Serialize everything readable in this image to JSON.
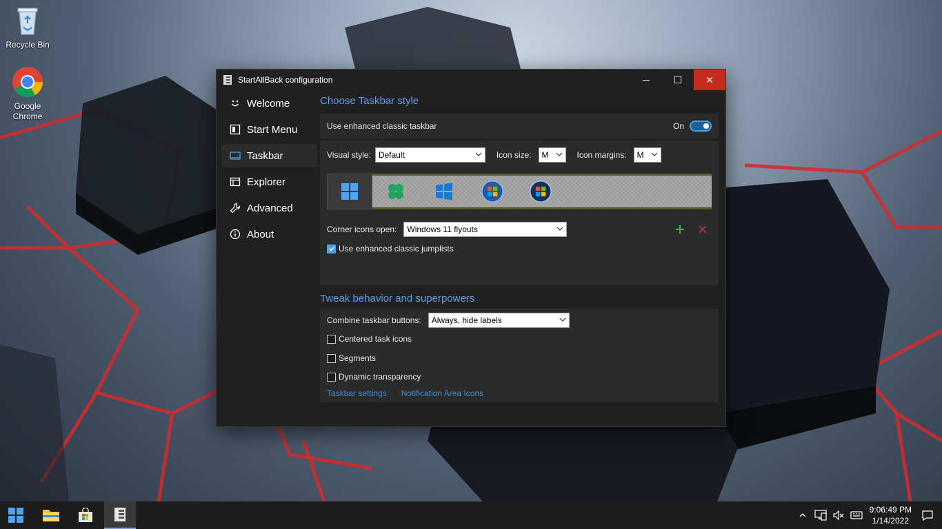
{
  "desktop": {
    "icons": [
      {
        "label": "Recycle Bin"
      },
      {
        "label": "Google Chrome"
      }
    ]
  },
  "window": {
    "title": "StartAllBack configuration",
    "controls": {
      "minimize": "─",
      "maximize": "☐",
      "close": "✕"
    }
  },
  "nav": {
    "items": [
      {
        "label": "Welcome",
        "icon": "smile-icon"
      },
      {
        "label": "Start Menu",
        "icon": "start-menu-icon"
      },
      {
        "label": "Taskbar",
        "icon": "taskbar-icon",
        "active": true
      },
      {
        "label": "Explorer",
        "icon": "folder-icon"
      },
      {
        "label": "Advanced",
        "icon": "wrench-icon"
      },
      {
        "label": "About",
        "icon": "info-icon"
      }
    ]
  },
  "taskbar_style": {
    "section_title": "Choose Taskbar style",
    "enhanced_label": "Use enhanced classic taskbar",
    "toggle_state": "On",
    "visual_style_label": "Visual style:",
    "visual_style_value": "Default",
    "icon_size_label": "Icon size:",
    "icon_size_value": "M",
    "icon_margins_label": "Icon margins:",
    "icon_margins_value": "M",
    "corner_label": "Corner icons open:",
    "corner_value": "Windows 11 flyouts",
    "jumplists_label": "Use enhanced classic jumplists",
    "jumplists_checked": true
  },
  "tweak": {
    "section_title": "Tweak behavior and superpowers",
    "combine_label": "Combine taskbar buttons:",
    "combine_value": "Always, hide labels",
    "centered_label": "Centered task icons",
    "segments_label": "Segments",
    "dynamic_label": "Dynamic transparency",
    "link_taskbar_settings": "Taskbar settings",
    "link_notification_icons": "Notification Area Icons"
  },
  "system_tray": {
    "time": "9:06:49 PM",
    "date": "1/14/2022"
  },
  "colors": {
    "accent": "#4c9ee5",
    "section_title": "#5f9ee8",
    "close_red": "#c42b1c",
    "add_green": "#3db44a",
    "remove_red": "#a33a3a"
  }
}
